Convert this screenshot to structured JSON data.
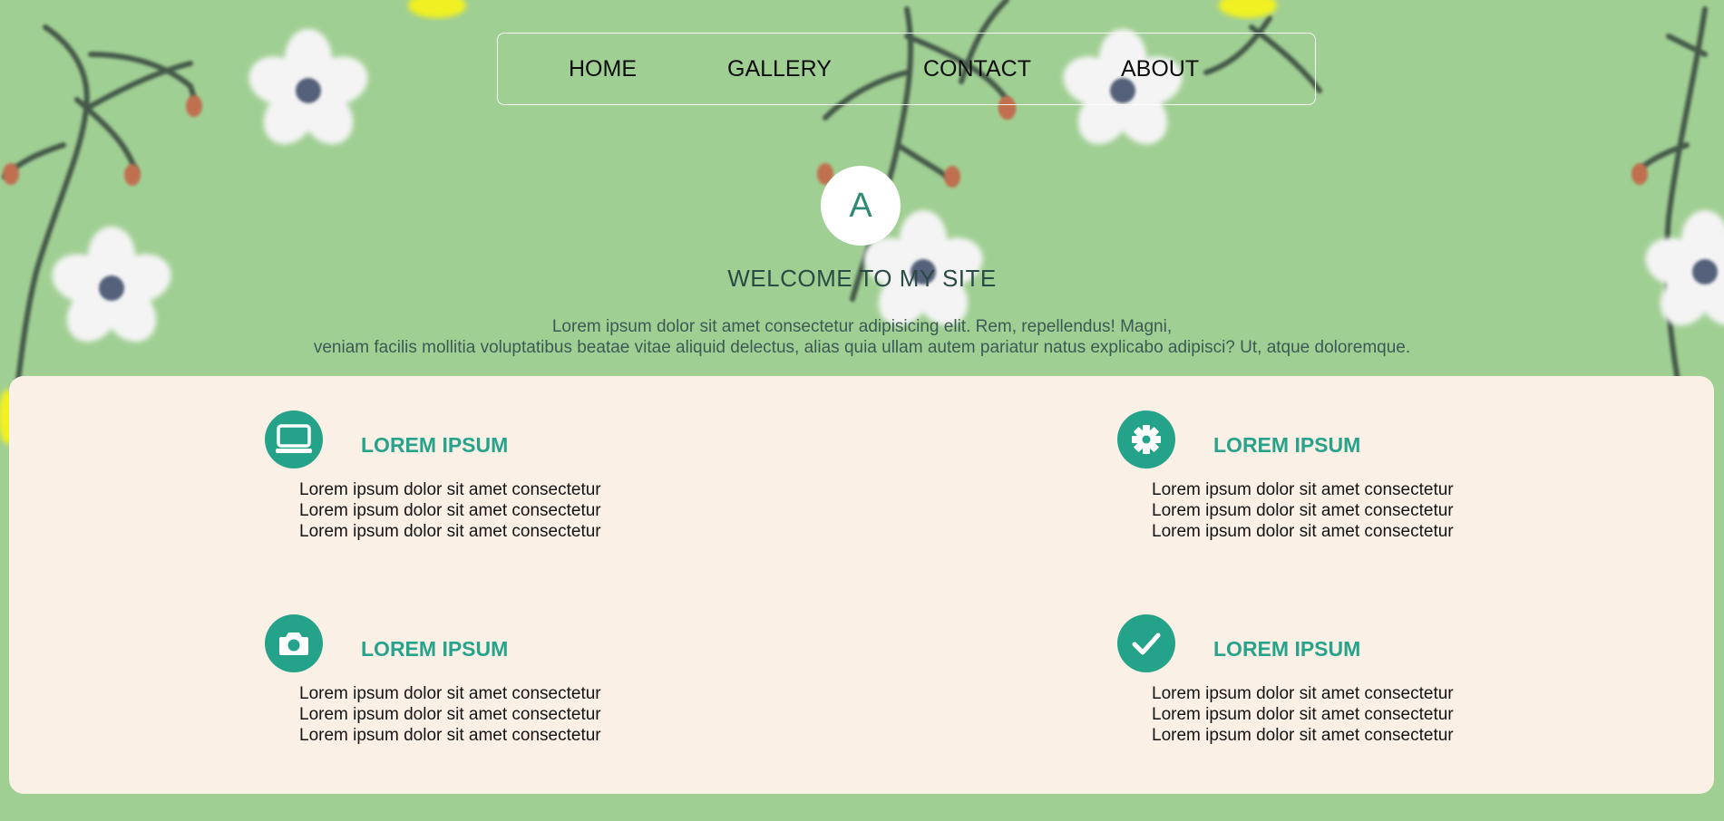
{
  "nav": {
    "items": [
      "HOME",
      "GALLERY",
      "CONTACT",
      "ABOUT"
    ]
  },
  "hero": {
    "avatar_letter": "A",
    "title": "WELCOME TO MY SITE",
    "intro": [
      "Lorem ipsum dolor sit amet consectetur adipisicing elit. Rem, repellendus! Magni,",
      "veniam facilis mollitia voluptatibus beatae vitae aliquid delectus, alias quia ullam autem pariatur natus explicabo adipisci? Ut, atque doloremque."
    ]
  },
  "features": [
    {
      "icon": "monitor-icon",
      "title": "LOREM IPSUM",
      "lines": [
        "Lorem ipsum dolor sit amet consectetur",
        "Lorem ipsum dolor sit amet consectetur",
        "Lorem ipsum dolor sit amet consectetur"
      ]
    },
    {
      "icon": "gear-icon",
      "title": "LOREM IPSUM",
      "lines": [
        "Lorem ipsum dolor sit amet consectetur",
        "Lorem ipsum dolor sit amet consectetur",
        "Lorem ipsum dolor sit amet consectetur"
      ]
    },
    {
      "icon": "camera-icon",
      "title": "LOREM IPSUM",
      "lines": [
        "Lorem ipsum dolor sit amet consectetur",
        "Lorem ipsum dolor sit amet consectetur",
        "Lorem ipsum dolor sit amet consectetur"
      ]
    },
    {
      "icon": "checkmark-icon",
      "title": "LOREM IPSUM",
      "lines": [
        "Lorem ipsum dolor sit amet consectetur",
        "Lorem ipsum dolor sit amet consectetur",
        "Lorem ipsum dolor sit amet consectetur"
      ]
    }
  ],
  "colors": {
    "background": "#a0cf93",
    "panel": "#faf0e6",
    "accent": "#25a38a",
    "title_text": "#28a38b"
  }
}
